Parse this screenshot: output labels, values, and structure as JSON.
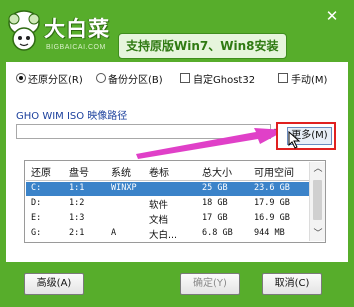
{
  "header": {
    "logo_title": "大白菜",
    "logo_sub": "BIGBAICAI.COM",
    "slogan": "支持原版Win7、Win8安装",
    "close_icon": "close-icon"
  },
  "options": {
    "restore": "还原分区(R)",
    "backup": "备份分区(B)",
    "custom_ghost": "自定Ghost32",
    "manual": "手动(M)",
    "selected": "restore"
  },
  "image_path": {
    "label": "GHO WIM ISO 映像路径",
    "value": "",
    "more_button": "更多(M)"
  },
  "table": {
    "headers": [
      "还原",
      "盘号",
      "系统",
      "卷标",
      "总大小",
      "可用空间"
    ],
    "rows": [
      {
        "restore": "C:",
        "disk": "1:1",
        "system": "WINXP",
        "label": "",
        "total": "25 GB",
        "free": "23.6 GB",
        "selected": true
      },
      {
        "restore": "D:",
        "disk": "1:2",
        "system": "",
        "label": "软件",
        "total": "18 GB",
        "free": "17.9 GB",
        "selected": false
      },
      {
        "restore": "E:",
        "disk": "1:3",
        "system": "",
        "label": "文档",
        "total": "17 GB",
        "free": "16.9 GB",
        "selected": false
      },
      {
        "restore": "G:",
        "disk": "2:1",
        "system": "A",
        "label": "大白...",
        "total": "6.8 GB",
        "free": "944 MB",
        "selected": false
      }
    ]
  },
  "footer": {
    "advanced": "高级(A)",
    "ok": "确定(Y)",
    "cancel": "取消(C)"
  },
  "colors": {
    "frame": "#57ad2b",
    "selection": "#3b83c9",
    "highlight_border": "#e02020",
    "annotation_arrow": "#e040c8"
  }
}
